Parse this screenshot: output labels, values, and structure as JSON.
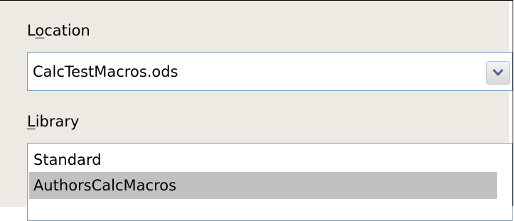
{
  "location": {
    "label": "Location",
    "label_underline_char": "o",
    "value": "CalcTestMacros.ods",
    "dropdown_icon": "chevron-down-icon"
  },
  "library": {
    "label": "Library",
    "label_underline_char": "L",
    "items": [
      {
        "label": "Standard",
        "selected": false
      },
      {
        "label": "AuthorsCalcMacros",
        "selected": true
      }
    ]
  },
  "colors": {
    "panel_background": "#ede9e3",
    "field_border": "#7f9db9",
    "selection_background": "#c1c1c1"
  }
}
